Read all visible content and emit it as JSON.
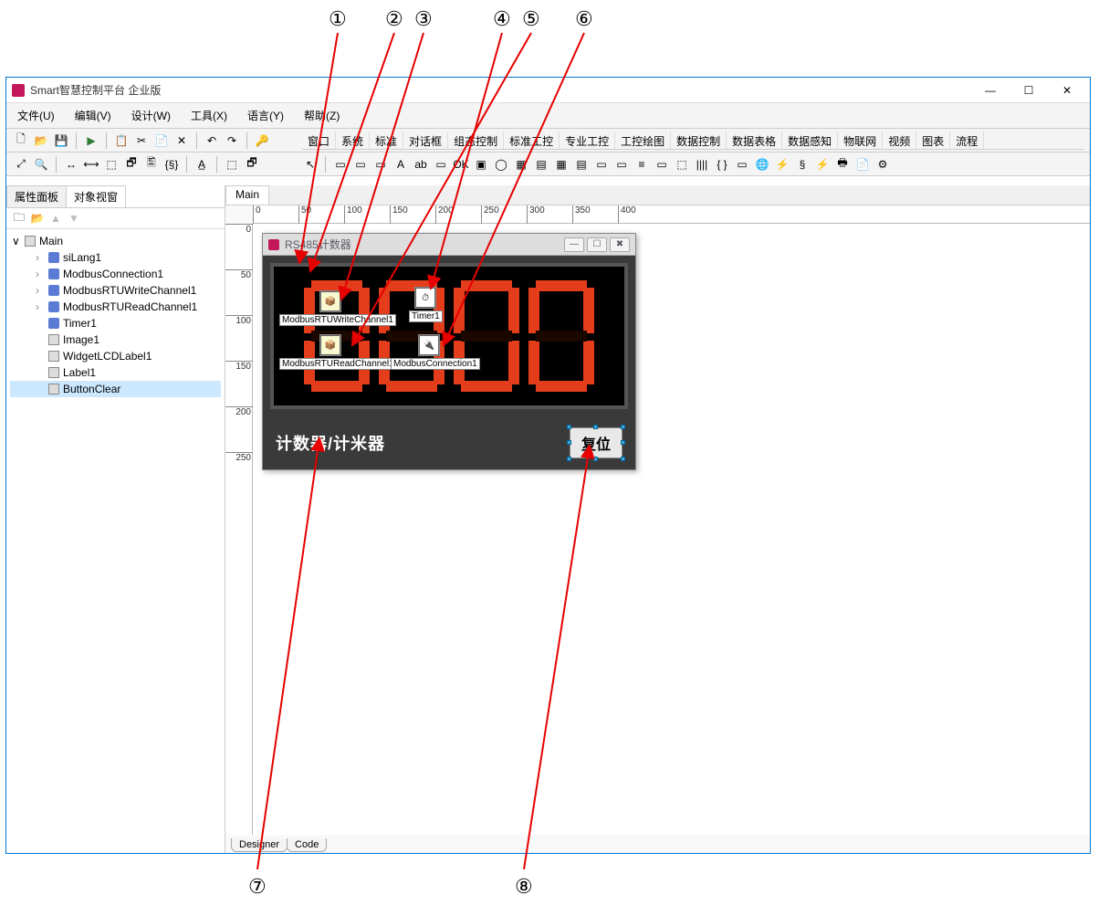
{
  "callouts": {
    "top": [
      "①",
      "②",
      "③",
      "④",
      "⑤",
      "⑥"
    ],
    "bottom": [
      "⑦",
      "⑧"
    ]
  },
  "window": {
    "title": "Smart智慧控制平台 企业版",
    "controls": {
      "min": "—",
      "max": "☐",
      "close": "✕"
    }
  },
  "menubar": [
    "文件(U)",
    "编辑(V)",
    "设计(W)",
    "工具(X)",
    "语言(Y)",
    "帮助(Z)"
  ],
  "toolbar1": [
    "🗋",
    "📂",
    "💾",
    "▶",
    "📋",
    "✂",
    "📄",
    "✕",
    "↶",
    "↷",
    "🔑"
  ],
  "ribbonTabs": [
    "窗口",
    "系统",
    "标准",
    "对话框",
    "组态控制",
    "标准工控",
    "专业工控",
    "工控绘图",
    "数据控制",
    "数据表格",
    "数据感知",
    "物联网",
    "视频",
    "图表",
    "流程"
  ],
  "toolbar2a": [
    "⤢",
    "🔍",
    "↔",
    "⟷",
    "⬚",
    "🗗",
    "🖺",
    "{§}",
    "A̲",
    "⬚",
    "🗗"
  ],
  "toolbar2b": [
    "↖",
    "▭",
    "▭",
    "▭",
    "A",
    "ab",
    "▭",
    "OK",
    "▣",
    "◯",
    "▦",
    "▤",
    "▦",
    "▤",
    "▭",
    "▭",
    "≡",
    "▭",
    "⬚",
    "||||",
    "{ }",
    "▭",
    "🌐",
    "⚡",
    "§",
    "⚡",
    "🖶",
    "📄",
    "⚙"
  ],
  "leftPanel": {
    "tabs": {
      "props": "属性面板",
      "objects": "对象视窗"
    },
    "tools": [
      "🗀",
      "📂",
      "▲",
      "▼"
    ],
    "root": {
      "name": "Main",
      "children": [
        {
          "name": "siLang1",
          "type": "comp"
        },
        {
          "name": "ModbusConnection1",
          "type": "comp"
        },
        {
          "name": "ModbusRTUWriteChannel1",
          "type": "comp"
        },
        {
          "name": "ModbusRTUReadChannel1",
          "type": "comp"
        },
        {
          "name": "Timer1",
          "type": "comp"
        },
        {
          "name": "Image1",
          "type": "lbl"
        },
        {
          "name": "WidgetLCDLabel1",
          "type": "lbl"
        },
        {
          "name": "Label1",
          "type": "lbl"
        },
        {
          "name": "ButtonClear",
          "type": "lbl",
          "selected": true
        }
      ]
    }
  },
  "designTab": "Main",
  "form": {
    "title": "RS485计数器",
    "lcdValue": "0000",
    "footerLabel": "计数器/计米器",
    "resetBtn": "复位",
    "placed": {
      "writeChannel": "ModbusRTUWriteChannel1",
      "readChannel": "ModbusRTUReadChannel1",
      "timer": "Timer1",
      "connection": "ModbusConnection1"
    }
  },
  "rulerH": [
    0,
    50,
    100,
    150,
    200,
    250,
    300,
    350,
    400
  ],
  "rulerV": [
    0,
    50,
    100,
    150,
    200,
    250
  ],
  "bottomTabs": {
    "designer": "Designer",
    "code": "Code"
  }
}
